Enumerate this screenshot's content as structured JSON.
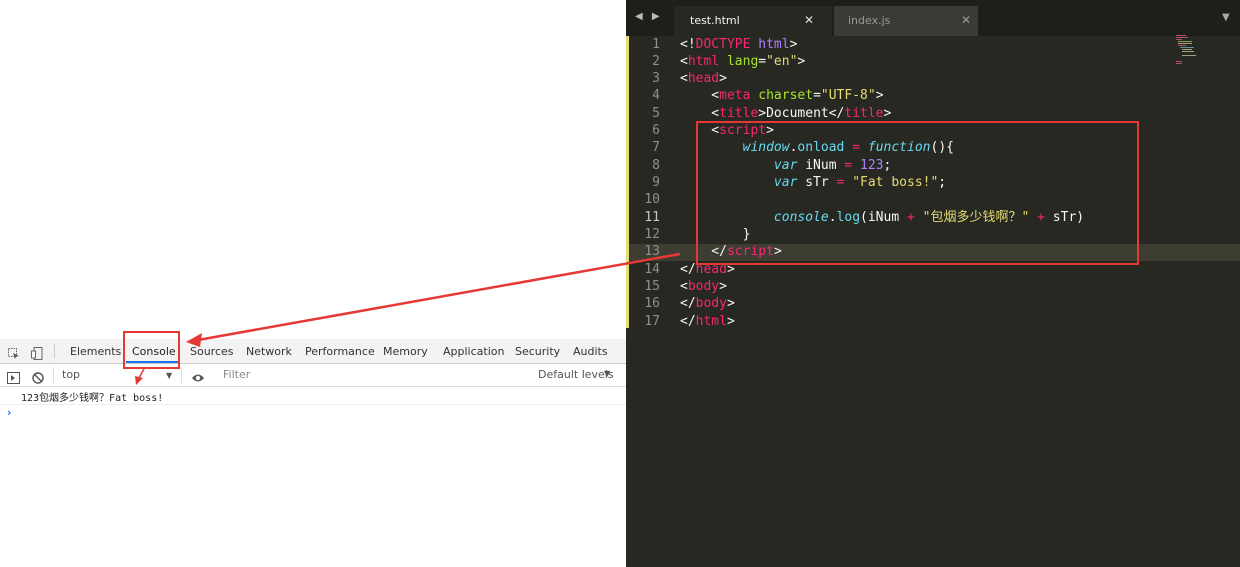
{
  "devtools": {
    "tabs": [
      "Elements",
      "Console",
      "Sources",
      "Network",
      "Performance",
      "Memory",
      "Application",
      "Security",
      "Audits"
    ],
    "context": "top",
    "filter_placeholder": "Filter",
    "levels": "Default levels",
    "levels_caret": "▼",
    "log_output": "123包烟多少钱啊？Fat boss!",
    "prompt": "›"
  },
  "editor": {
    "nav_arrows": "◀ ▶",
    "tabs": [
      {
        "label": "test.html",
        "close": "✕"
      },
      {
        "label": "index.js",
        "close": "✕"
      }
    ],
    "tab_menu": "▼",
    "line_numbers": [
      "1",
      "2",
      "3",
      "4",
      "5",
      "6",
      "7",
      "8",
      "9",
      "10",
      "11",
      "12",
      "13",
      "14",
      "15",
      "16",
      "17"
    ],
    "code": {
      "l1a": "<!",
      "l1b": "DOCTYPE",
      "l1c": " ",
      "l1d": "html",
      "l1e": ">",
      "l2a": "<",
      "l2b": "html",
      "l2c": " ",
      "l2d": "lang",
      "l2e": "=",
      "l2f": "\"en\"",
      "l2g": ">",
      "l3a": "<",
      "l3b": "head",
      "l3c": ">",
      "l4a": "    <",
      "l4b": "meta",
      "l4c": " ",
      "l4d": "charset",
      "l4e": "=",
      "l4f": "\"UTF-8\"",
      "l4g": ">",
      "l5a": "    <",
      "l5b": "title",
      "l5c": ">Document</",
      "l5d": "title",
      "l5e": ">",
      "l6a": "    <",
      "l6b": "script",
      "l6c": ">",
      "l7a": "        ",
      "l7b": "window",
      "l7c": ".",
      "l7d": "onload",
      "l7e": " = ",
      "l7f": "function",
      "l7g": "(){",
      "l8a": "            ",
      "l8b": "var",
      "l8c": " iNum ",
      "l8d": "=",
      "l8e": " ",
      "l8f": "123",
      "l8g": ";",
      "l9a": "            ",
      "l9b": "var",
      "l9c": " sTr ",
      "l9d": "=",
      "l9e": " ",
      "l9f": "\"Fat boss!\"",
      "l9g": ";",
      "l11a": "            ",
      "l11b": "console",
      "l11c": ".",
      "l11d": "log",
      "l11e": "(iNum ",
      "l11f": "+",
      "l11g": " ",
      "l11h": "\"包烟多少钱啊？\"",
      "l11i": " ",
      "l11j": "+",
      "l11k": " sTr)",
      "l12a": "        }",
      "l13a": "    </",
      "l13b": "script",
      "l13c": ">",
      "l14a": "</",
      "l14b": "head",
      "l14c": ">",
      "l15a": "<",
      "l15b": "body",
      "l15c": ">",
      "l16a": "</",
      "l16b": "body",
      "l16c": ">",
      "l17a": "</",
      "l17b": "html",
      "l17c": ">"
    }
  },
  "colors": {
    "annotation_red": "#e53935",
    "editor_bg": "#272822",
    "devtools_active_tab": "#1a73e8"
  }
}
